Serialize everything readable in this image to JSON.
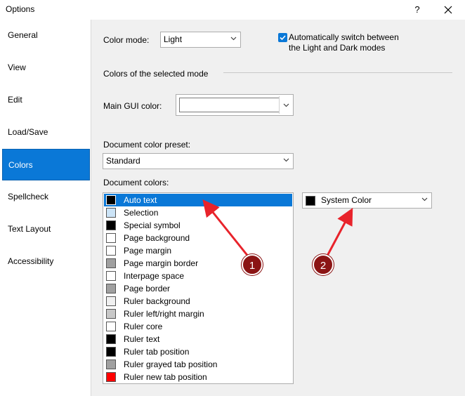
{
  "window": {
    "title": "Options",
    "help_glyph": "?",
    "close_glyph": "✕"
  },
  "sidebar": {
    "items": [
      {
        "label": "General",
        "active": false
      },
      {
        "label": "View",
        "active": false
      },
      {
        "label": "Edit",
        "active": false
      },
      {
        "label": "Load/Save",
        "active": false
      },
      {
        "label": "Colors",
        "active": true
      },
      {
        "label": "Spellcheck",
        "active": false
      },
      {
        "label": "Text Layout",
        "active": false
      },
      {
        "label": "Accessibility",
        "active": false
      }
    ]
  },
  "colors_page": {
    "color_mode_label": "Color mode:",
    "color_mode_value": "Light",
    "auto_switch_label_line1": "Automatically switch between",
    "auto_switch_label_line2": "the Light and Dark modes",
    "auto_switch_checked": true,
    "section_heading": "Colors of the selected mode",
    "main_gui_color_label": "Main GUI color:",
    "main_gui_color_value": "",
    "preset_label": "Document color preset:",
    "preset_value": "Standard",
    "document_colors_label": "Document colors:",
    "document_colors": [
      {
        "label": "Auto text",
        "color": "#000000",
        "selected": true
      },
      {
        "label": "Selection",
        "color": "#cce4f7",
        "selected": false
      },
      {
        "label": "Special symbol",
        "color": "#000000",
        "selected": false
      },
      {
        "label": "Page background",
        "color": "#ffffff",
        "selected": false
      },
      {
        "label": "Page margin",
        "color": "#ffffff",
        "selected": false
      },
      {
        "label": "Page margin border",
        "color": "#a0a0a0",
        "selected": false
      },
      {
        "label": "Interpage space",
        "color": "#ffffff",
        "selected": false
      },
      {
        "label": "Page border",
        "color": "#a0a0a0",
        "selected": false
      },
      {
        "label": "Ruler background",
        "color": "#f0f0f0",
        "selected": false
      },
      {
        "label": "Ruler left/right margin",
        "color": "#c8c8c8",
        "selected": false
      },
      {
        "label": "Ruler core",
        "color": "#ffffff",
        "selected": false
      },
      {
        "label": "Ruler text",
        "color": "#000000",
        "selected": false
      },
      {
        "label": "Ruler tab position",
        "color": "#000000",
        "selected": false
      },
      {
        "label": "Ruler grayed tab position",
        "color": "#a0a0a0",
        "selected": false
      },
      {
        "label": "Ruler new tab position",
        "color": "#ff0000",
        "selected": false
      }
    ],
    "selected_color_value": "System Color",
    "selected_color_swatch": "#000000"
  },
  "annotations": [
    {
      "number": "1"
    },
    {
      "number": "2"
    }
  ],
  "accent_color": "#0a78d7",
  "annotation_color": "#e8232b"
}
